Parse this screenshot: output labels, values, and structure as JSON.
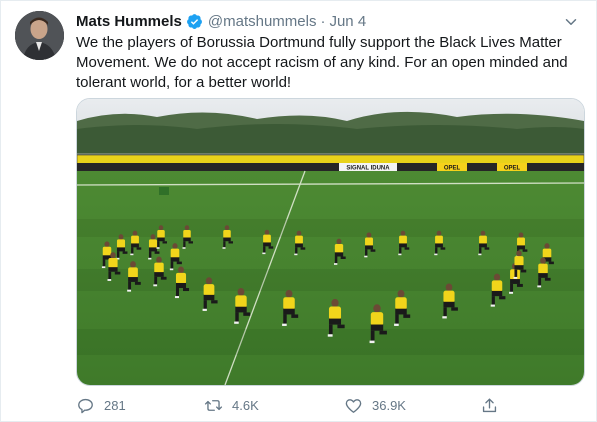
{
  "tweet": {
    "author_name": "Mats Hummels",
    "handle": "@matshummels",
    "separator": "·",
    "date": "Jun 4",
    "text": "We the players of Borussia Dortmund fully support the Black Lives Matter Movement. We do not accept racism of any kind. For an open minded and tolerant world, for a better world!",
    "verified_icon": "verified-badge-icon",
    "verified_color": "#1da1f2",
    "text_color": "#14171a",
    "muted_color": "#657786"
  },
  "actions": {
    "replies": "281",
    "retweets": "4.6K",
    "likes": "36.9K"
  },
  "media": {
    "banner_texts": [
      "SIGNAL IDUNA",
      "OPEL",
      "OPEL"
    ],
    "player_count": 26
  }
}
